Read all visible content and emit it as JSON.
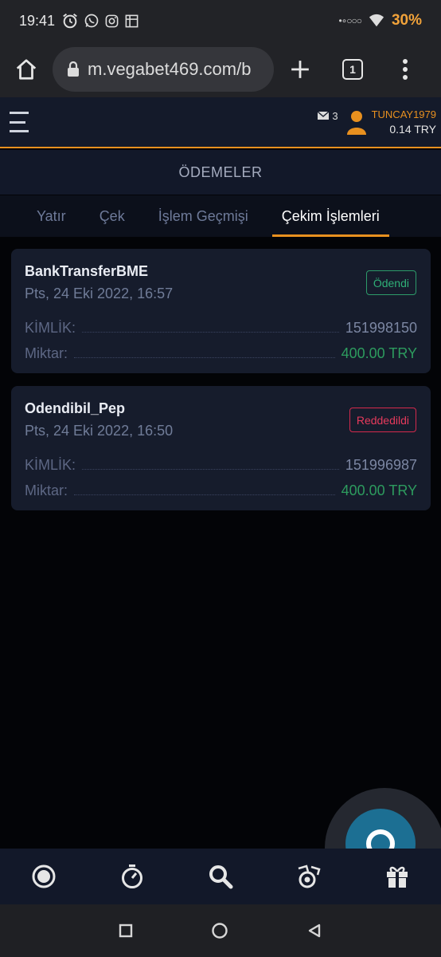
{
  "status_bar": {
    "time": "19:41",
    "battery": "30%"
  },
  "browser": {
    "url": "m.vegabet469.com/b",
    "tab_count": "1"
  },
  "header": {
    "mail_count": "3",
    "username": "TUNCAY1979",
    "balance": "0.14 TRY"
  },
  "page": {
    "title": "ÖDEMELER"
  },
  "tabs": [
    {
      "label": "Yatır",
      "active": false
    },
    {
      "label": "Çek",
      "active": false
    },
    {
      "label": "İşlem Geçmişi",
      "active": false
    },
    {
      "label": "Çekim İşlemleri",
      "active": true
    }
  ],
  "transactions": [
    {
      "method": "BankTransferBME",
      "date": "Pts, 24 Eki 2022, 16:57",
      "status": "Ödendi",
      "id_label": "KİMLİK:",
      "id": "151998150",
      "amount_label": "Miktar:",
      "amount": "400.00 TRY"
    },
    {
      "method": "Odendibil_Pep",
      "date": "Pts, 24 Eki 2022, 16:50",
      "status": "Reddedildi",
      "id_label": "KİMLİK:",
      "id": "151996987",
      "amount_label": "Miktar:",
      "amount": "400.00 TRY"
    }
  ],
  "colors": {
    "accent": "#e8901f",
    "success": "#2fb077",
    "danger": "#e63a5c",
    "card_bg": "#161c2c"
  },
  "bottom_nav": [
    {
      "icon": "live-icon"
    },
    {
      "icon": "stopwatch-icon"
    },
    {
      "icon": "search-icon"
    },
    {
      "icon": "casino-icon"
    },
    {
      "icon": "gift-icon"
    }
  ]
}
